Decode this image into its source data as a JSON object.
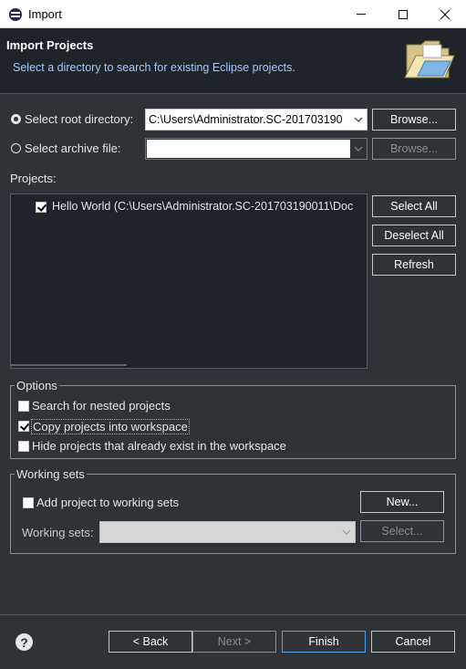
{
  "window": {
    "title": "Import",
    "icon": "eclipse-icon"
  },
  "header": {
    "title": "Import Projects",
    "subtitle": "Select a directory to search for existing Eclipse projects.",
    "icon": "folder-icon"
  },
  "source": {
    "root_directory": {
      "label": "Select root directory:",
      "value": "C:\\Users\\Administrator.SC-201703190",
      "browse_label": "Browse...",
      "selected": true
    },
    "archive_file": {
      "label": "Select archive file:",
      "value": "",
      "browse_label": "Browse...",
      "selected": false
    }
  },
  "projects": {
    "label": "Projects:",
    "items": [
      {
        "label": "Hello World (C:\\Users\\Administrator.SC-201703190011\\Doc",
        "checked": true
      }
    ],
    "buttons": {
      "select_all": "Select All",
      "deselect_all": "Deselect All",
      "refresh": "Refresh"
    }
  },
  "options": {
    "title": "Options",
    "items": [
      {
        "label": "Search for nested projects",
        "checked": false
      },
      {
        "label": "Copy projects into workspace",
        "checked": true
      },
      {
        "label": "Hide projects that already exist in the workspace",
        "checked": false
      }
    ]
  },
  "working_sets": {
    "title": "Working sets",
    "add_label": "Add project to working sets",
    "add_checked": false,
    "new_label": "New...",
    "sets_label": "Working sets:",
    "sets_value": "",
    "select_label": "Select..."
  },
  "footer": {
    "help_icon": "help-icon",
    "back_label": "< Back",
    "next_label": "Next >",
    "finish_label": "Finish",
    "cancel_label": "Cancel"
  },
  "colors": {
    "background": "#2f3237",
    "header_bg": "#1f232a",
    "subtitle": "#9ecbff",
    "focus": "#5a9ee6"
  }
}
